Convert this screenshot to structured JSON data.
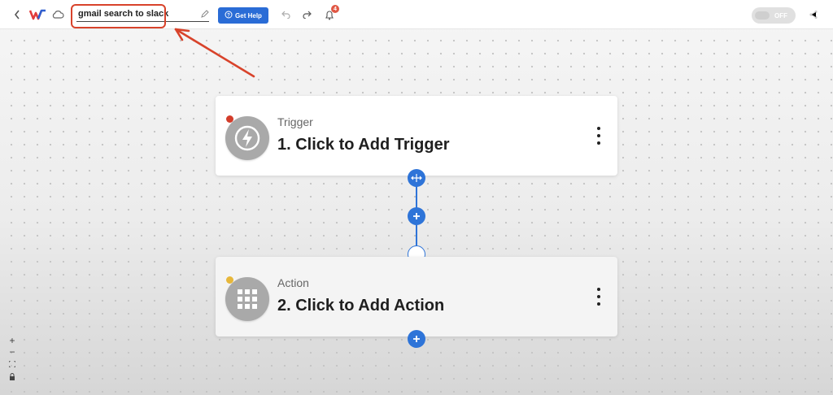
{
  "topbar": {
    "back_icon": "chevron-left-icon",
    "logo_icon": "w-logo-icon",
    "cloud_icon": "cloud-icon",
    "workflow_name": "gmail search to slack",
    "edit_icon": "pencil-icon",
    "help_button_label": "Get Help",
    "help_icon": "question-circle-icon",
    "undo_icon": "undo-icon",
    "redo_icon": "redo-icon",
    "bell_icon": "bell-icon",
    "notification_count": "4",
    "toggle_label": "OFF",
    "share_icon": "share-icon"
  },
  "colors": {
    "accent": "#2e74d8",
    "annotation": "#d8432b",
    "trigger_dot": "#d33c2a",
    "action_dot": "#e7b73a"
  },
  "flow": {
    "trigger": {
      "type_label": "Trigger",
      "title": "1. Click to Add Trigger",
      "icon": "lightning-icon"
    },
    "action": {
      "type_label": "Action",
      "title": "2. Click to Add Action",
      "icon": "grid-icon"
    }
  },
  "zoom_controls": {
    "zoom_in": "+",
    "zoom_out": "−"
  }
}
